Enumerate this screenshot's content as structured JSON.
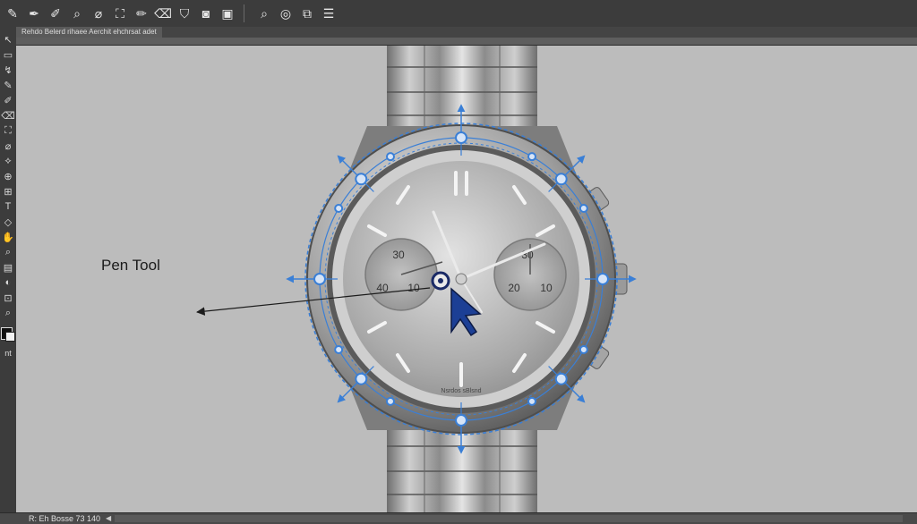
{
  "app": {
    "document_tab": "Rehdo Belerd rihaee Aerchit ehchrsat adet"
  },
  "toolbar": {
    "buttons": [
      {
        "name": "pencil-icon",
        "glyph": "✎"
      },
      {
        "name": "pen-icon",
        "glyph": "✒"
      },
      {
        "name": "brush-icon",
        "glyph": "✐"
      },
      {
        "name": "zoom-icon",
        "glyph": "⌕"
      },
      {
        "name": "eyedropper-icon",
        "glyph": "⌀"
      },
      {
        "name": "crop-icon",
        "glyph": "⛶"
      },
      {
        "name": "shape-edit-icon",
        "glyph": "✏"
      },
      {
        "name": "eraser-icon",
        "glyph": "⌫"
      },
      {
        "name": "path-select-icon",
        "glyph": "⛉"
      },
      {
        "name": "camera-icon",
        "glyph": "◙"
      },
      {
        "name": "screen-icon",
        "glyph": "▣"
      }
    ],
    "buttons_right": [
      {
        "name": "search-icon",
        "glyph": "⌕"
      },
      {
        "name": "lasso-icon",
        "glyph": "◎"
      },
      {
        "name": "layers-icon",
        "glyph": "⧉"
      },
      {
        "name": "stack-icon",
        "glyph": "☰"
      }
    ]
  },
  "toolbox": {
    "tools": [
      {
        "name": "tool-move-icon",
        "glyph": "↖"
      },
      {
        "name": "tool-marquee-icon",
        "glyph": "▭"
      },
      {
        "name": "tool-lasso-icon",
        "glyph": "↯"
      },
      {
        "name": "tool-pen-icon",
        "glyph": "✎"
      },
      {
        "name": "tool-brush-icon",
        "glyph": "✐"
      },
      {
        "name": "tool-eraser-icon",
        "glyph": "⌫"
      },
      {
        "name": "tool-crop-icon",
        "glyph": "⛶"
      },
      {
        "name": "tool-eyedropper-icon",
        "glyph": "⌀"
      },
      {
        "name": "tool-path-icon",
        "glyph": "⟡"
      },
      {
        "name": "tool-heal-icon",
        "glyph": "⊕"
      },
      {
        "name": "tool-stamp-icon",
        "glyph": "⊞"
      },
      {
        "name": "tool-type-icon",
        "glyph": "T"
      },
      {
        "name": "tool-shape-icon",
        "glyph": "◇"
      },
      {
        "name": "tool-hand-icon",
        "glyph": "✋"
      },
      {
        "name": "tool-zoom-icon",
        "glyph": "⌕"
      },
      {
        "name": "tool-gradient-icon",
        "glyph": "▤"
      },
      {
        "name": "tool-dodge-icon",
        "glyph": "◐"
      },
      {
        "name": "tool-edit-icon",
        "glyph": "⊡"
      },
      {
        "name": "tool-search-icon",
        "glyph": "⌕"
      }
    ],
    "label": "nt"
  },
  "canvas": {
    "annotation_label": "Pen Tool",
    "watch": {
      "subdial_left": {
        "top": "30",
        "left": "40",
        "right": "10"
      },
      "subdial_right": {
        "top": "30",
        "left": "20",
        "right": "10"
      },
      "dial_text": "Nsrdos sBlsnd"
    }
  },
  "status": {
    "text": "R: Eh Bosse 73 140"
  },
  "colors": {
    "canvas_bg": "#bcbcbc",
    "path_blue": "#3a7fd6",
    "anchor_dark": "#1a2a66"
  }
}
